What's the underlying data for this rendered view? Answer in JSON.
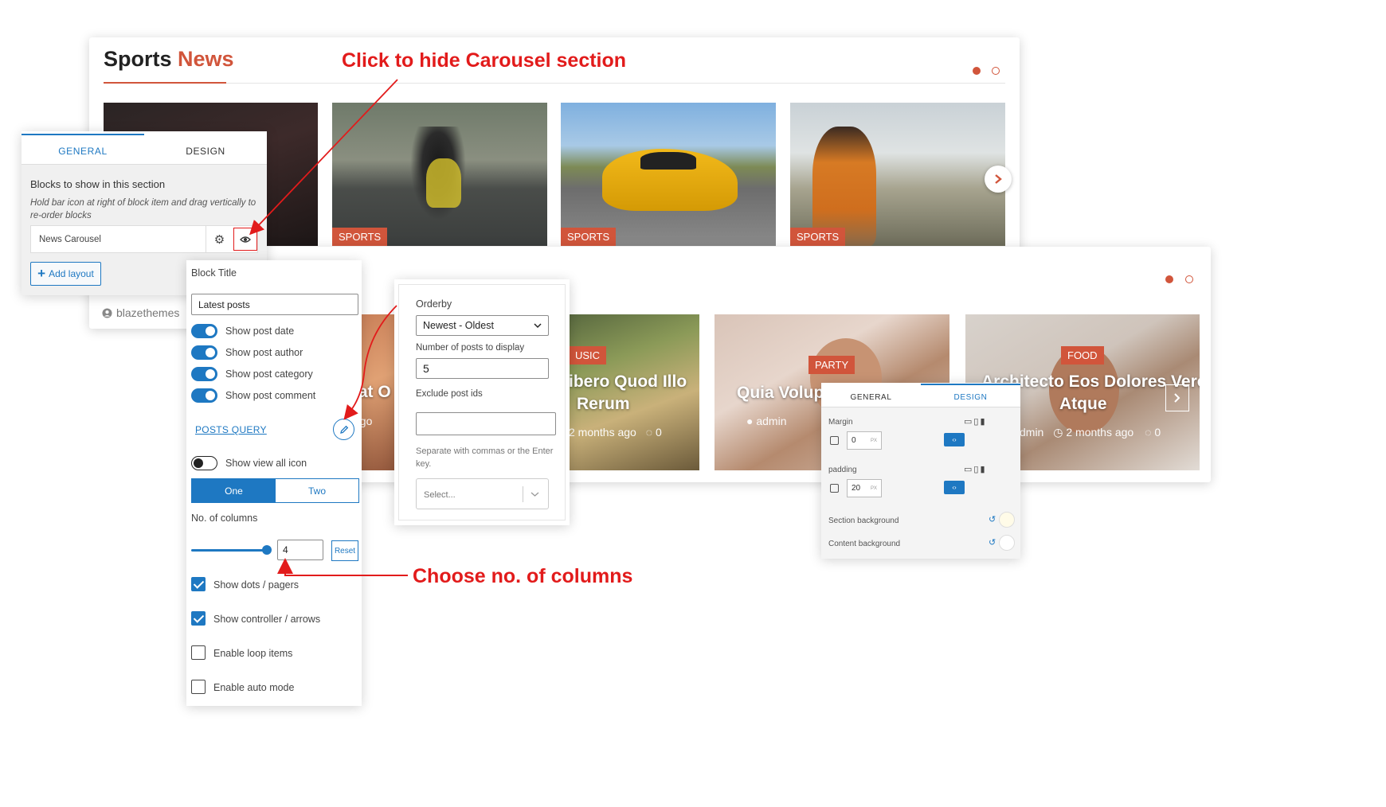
{
  "sports_card": {
    "title_main": "Sports",
    "title_accent": "News",
    "slides": [
      {
        "category": "SPORTS"
      },
      {
        "category": "SPORTS"
      },
      {
        "category": "SPORTS"
      }
    ],
    "author": "blazethemes"
  },
  "annotations": {
    "hide_carousel": "Click to hide Carousel section",
    "choose_columns": "Choose no. of columns"
  },
  "second_card": {
    "slides": [
      {
        "category": "USIC",
        "title": "ibero Quod Illo",
        "title2": "Rerum",
        "meta": "2 months ago",
        "comments": "0"
      },
      {
        "category": "PARTY",
        "title": "Quia Volupt",
        "author": "admin"
      },
      {
        "category": "FOOD",
        "title": "Architecto Eos Dolores Vero",
        "title2": "Atque",
        "author": "dmin",
        "meta": "2 months ago",
        "comments": "0"
      }
    ],
    "partial_title": "iat O",
    "partial_meta": "ago"
  },
  "panel_blocks": {
    "tabs": [
      "GENERAL",
      "DESIGN"
    ],
    "heading": "Blocks to show in this section",
    "hint": "Hold bar icon at right of block item and drag vertically to re-order blocks",
    "block_item": "News Carousel",
    "add_layout": "Add layout"
  },
  "panel_block_settings": {
    "block_title_label": "Block Title",
    "block_title_value": "Latest posts",
    "toggles": [
      {
        "label": "Show post date",
        "on": true
      },
      {
        "label": "Show post author",
        "on": true
      },
      {
        "label": "Show post category",
        "on": true
      },
      {
        "label": "Show post comment",
        "on": true
      }
    ],
    "posts_query": "POSTS QUERY",
    "view_all": "Show view all icon",
    "seg": [
      "One",
      "Two"
    ],
    "columns_label": "No. of columns",
    "columns_value": "4",
    "reset": "Reset",
    "slider_fraction": 0.92,
    "checks": [
      {
        "label": "Show dots / pagers",
        "on": true
      },
      {
        "label": "Show controller / arrows",
        "on": true
      },
      {
        "label": "Enable loop items",
        "on": false
      },
      {
        "label": "Enable auto mode",
        "on": false
      }
    ]
  },
  "panel_query": {
    "orderby_label": "Orderby",
    "orderby_value": "Newest - Oldest",
    "count_label": "Number of posts to display",
    "count_value": "5",
    "exclude_label": "Exclude post ids",
    "exclude_hint": "Separate with commas or the Enter key.",
    "select_placeholder": "Select..."
  },
  "panel_design": {
    "tabs": [
      "GENERAL",
      "DESIGN"
    ],
    "margin_label": "Margin",
    "margin_value": "0",
    "padding_label": "padding",
    "padding_value": "20",
    "unit": "PX",
    "section_bg": "Section background",
    "content_bg": "Content background"
  },
  "colors": {
    "accent": "#d1553b",
    "blue": "#1e78c2",
    "annotation": "#e21b1b"
  }
}
